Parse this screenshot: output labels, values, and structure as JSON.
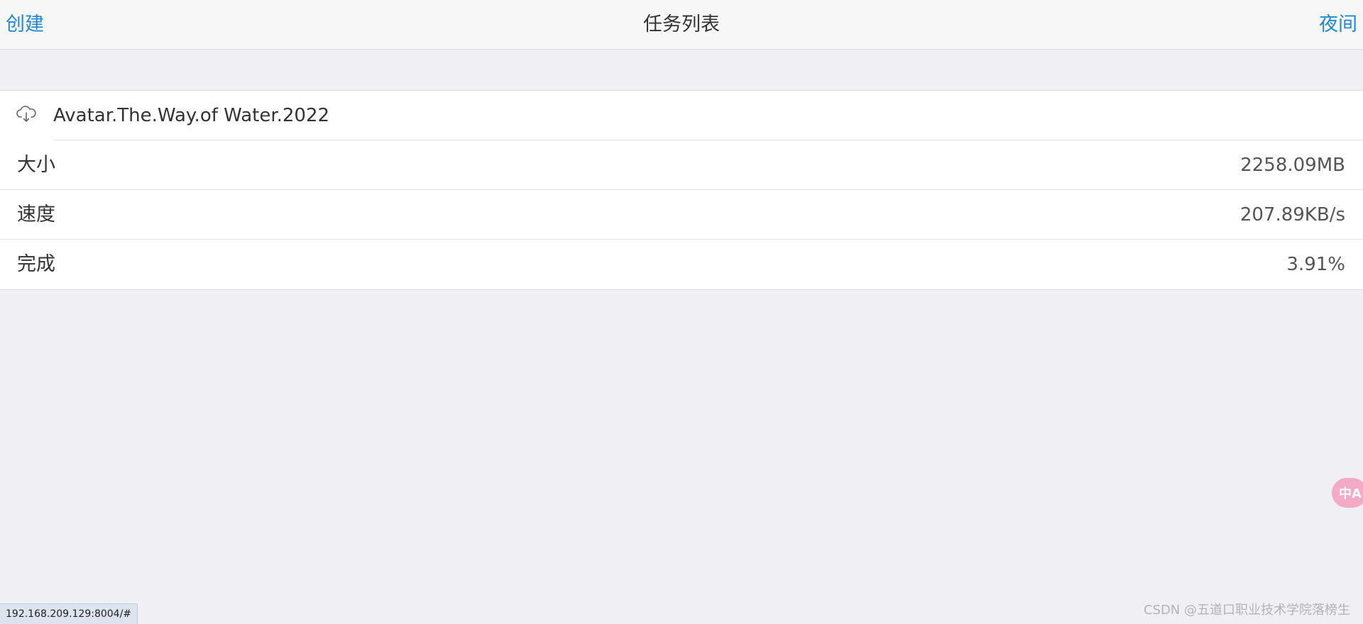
{
  "navbar": {
    "left_label": "创建",
    "title": "任务列表",
    "right_label": "夜间"
  },
  "task": {
    "icon": "cloud-download-icon",
    "name": "Avatar.The.Way.of Water.2022",
    "rows": [
      {
        "label": "大小",
        "value": "2258.09MB"
      },
      {
        "label": "速度",
        "value": "207.89KB/s"
      },
      {
        "label": "完成",
        "value": "3.91%"
      }
    ]
  },
  "status_bar": {
    "url": "192.168.209.129:8004/#"
  },
  "watermark": "CSDN @五道口职业技术学院落榜生",
  "translate_button": {
    "icon": "translate-icon",
    "glyph": "中A"
  },
  "colors": {
    "accent": "#1e88d6",
    "background": "#efeff4",
    "navbar": "#f7f7f7",
    "translate_button": "#f4a9c4"
  }
}
